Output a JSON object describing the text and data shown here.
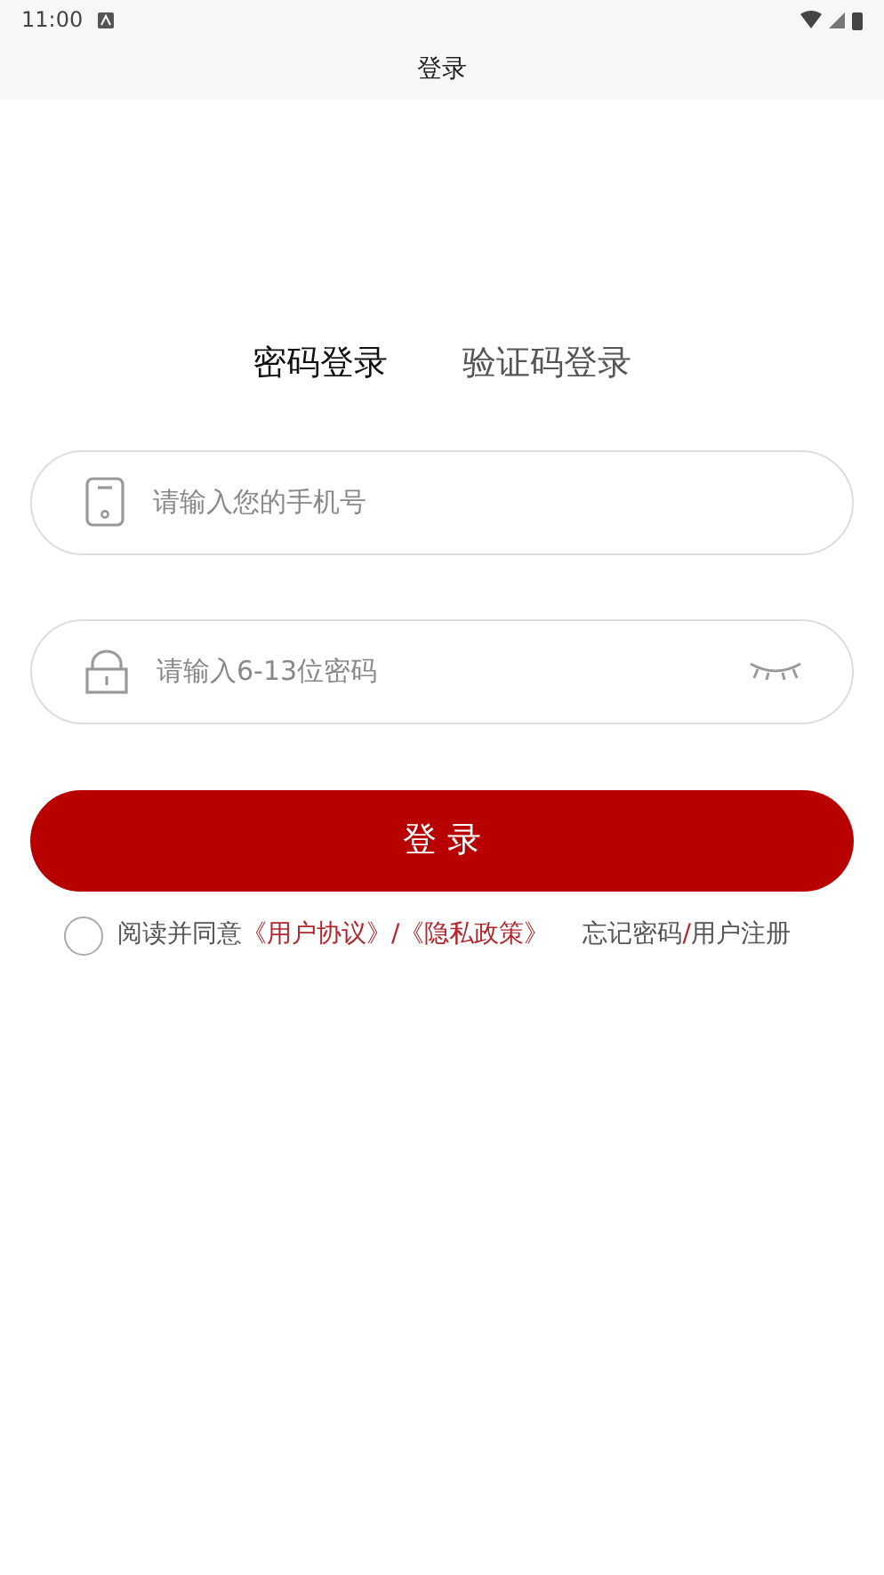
{
  "status_bar": {
    "time": "11:00"
  },
  "header": {
    "title": "登录"
  },
  "tabs": [
    {
      "label": "密码登录",
      "selected": true
    },
    {
      "label": "验证码登录",
      "selected": false
    }
  ],
  "fields": [
    {
      "kind": "phone",
      "placeholder": "请输入您的手机号"
    },
    {
      "kind": "password",
      "placeholder": "请输入6-13位密码"
    }
  ],
  "login_button": "登 录",
  "agreement": {
    "checked": false,
    "prefix": "阅读并同意",
    "links": [
      "《用户协议》",
      "《隐私政策》"
    ],
    "separator": "/"
  },
  "links": [
    {
      "label": "忘记密码"
    },
    {
      "label": "/"
    },
    {
      "label": "用户注册"
    }
  ]
}
